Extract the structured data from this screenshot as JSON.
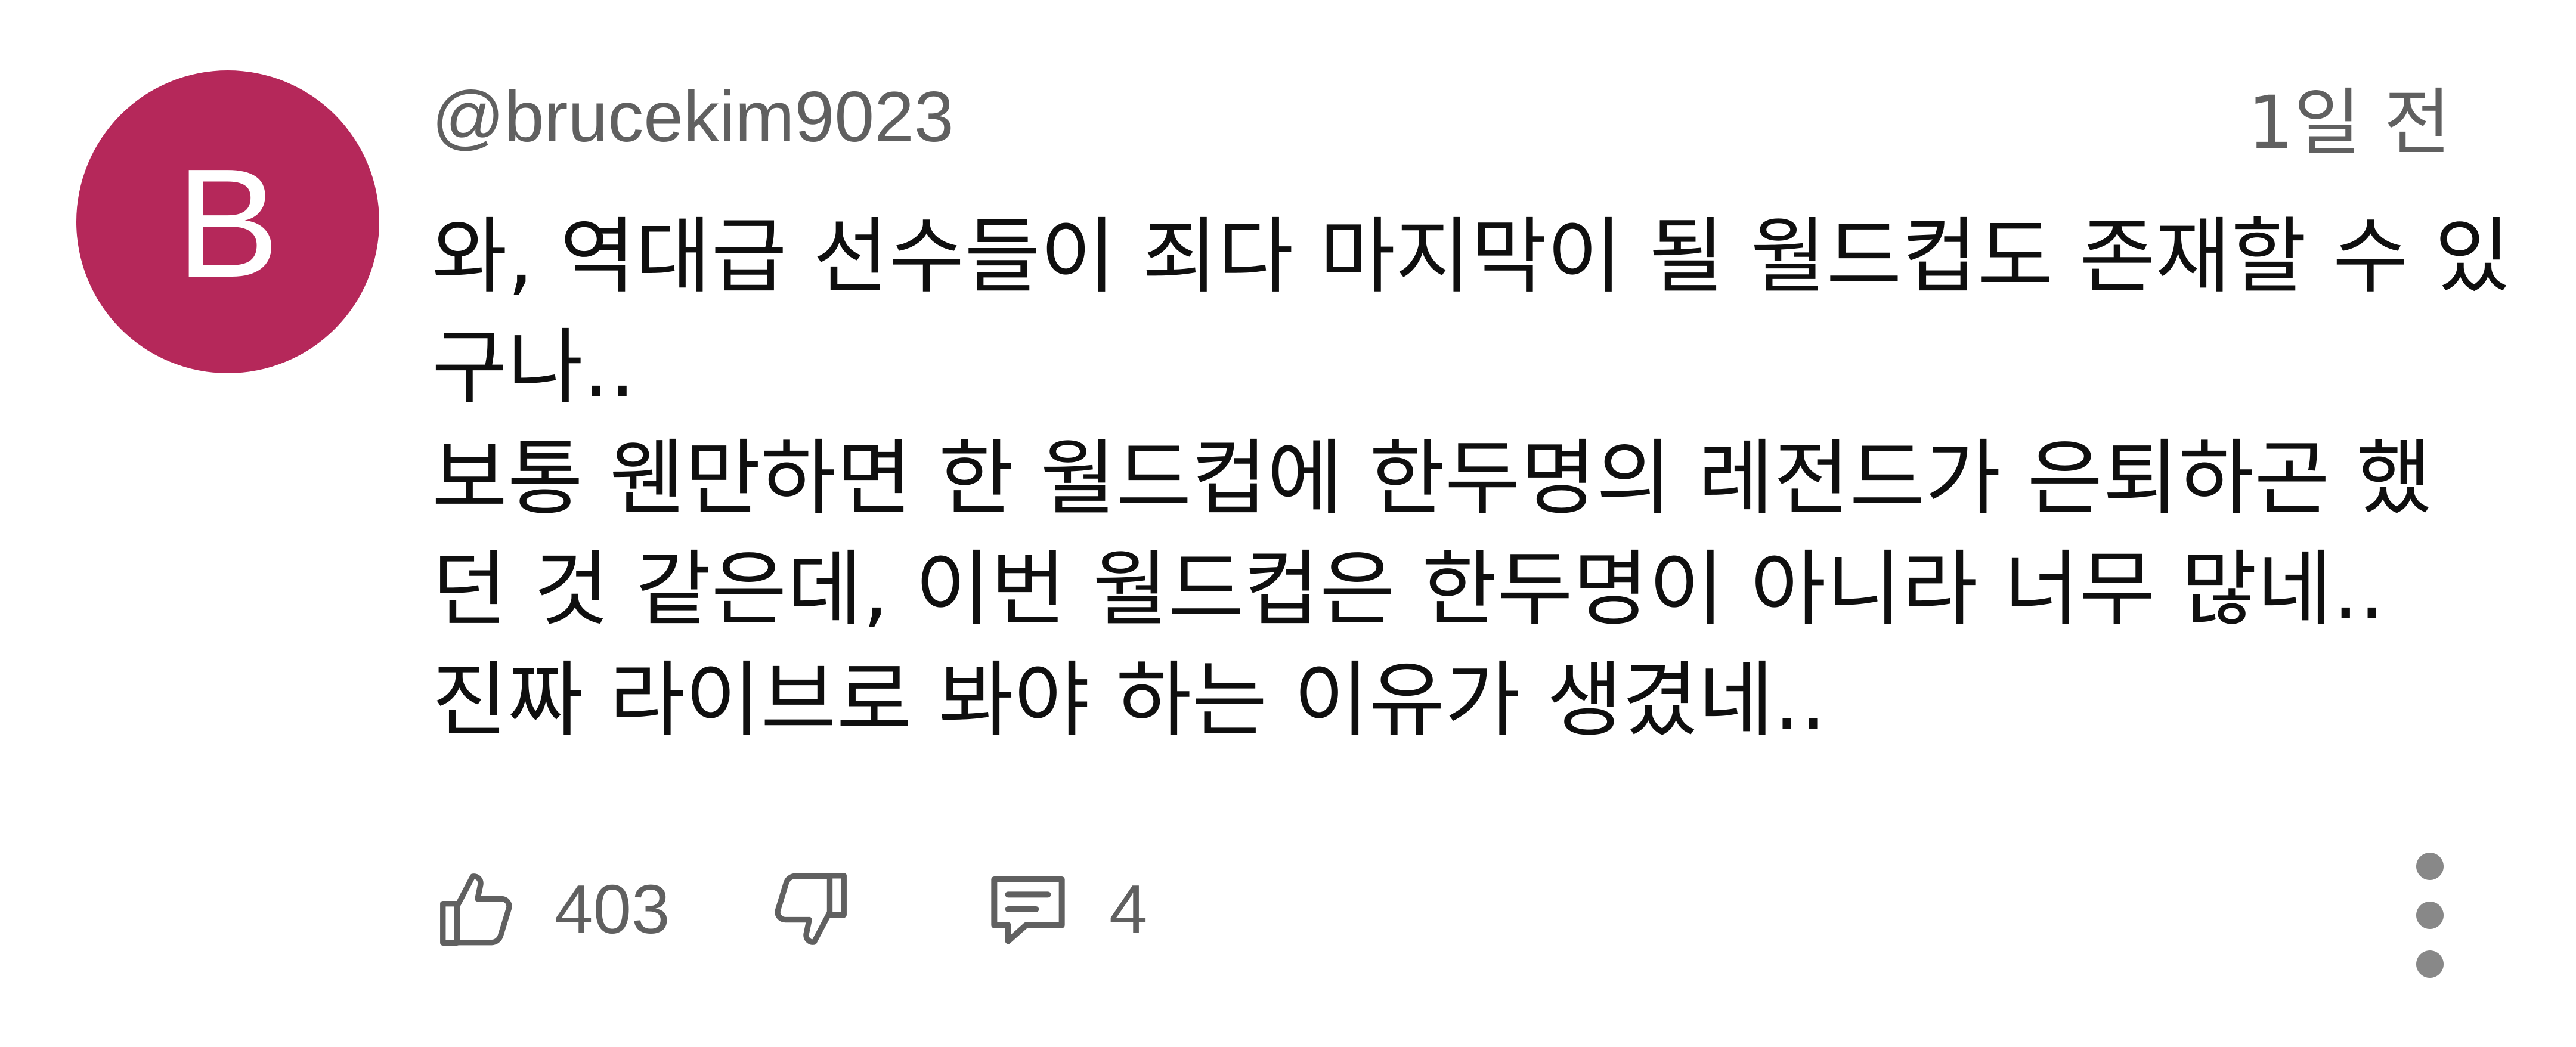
{
  "comment": {
    "avatar_letter": "B",
    "author": "@brucekim9023",
    "timestamp": "1일 전",
    "body_lines": [
      "와, 역대급 선수들이 죄다 마지막이 될 월드컵도 존재할 수 있",
      "구나..",
      "보통 웬만하면 한 월드컵에 한두명의 레전드가 은퇴하곤 했",
      "던 것 같은데, 이번 월드컵은 한두명이 아니라 너무 많네..",
      "진짜 라이브로 봐야 하는 이유가 생겼네.."
    ],
    "like_count": "403",
    "reply_count": "4"
  },
  "icons": {
    "like": "thumbs-up-icon",
    "dislike": "thumbs-down-icon",
    "reply": "comment-icon",
    "more": "more-vertical-icon"
  },
  "colors": {
    "avatar_bg": "#b5285a",
    "secondary_text": "#606060",
    "primary_text": "#0f0f0f"
  }
}
